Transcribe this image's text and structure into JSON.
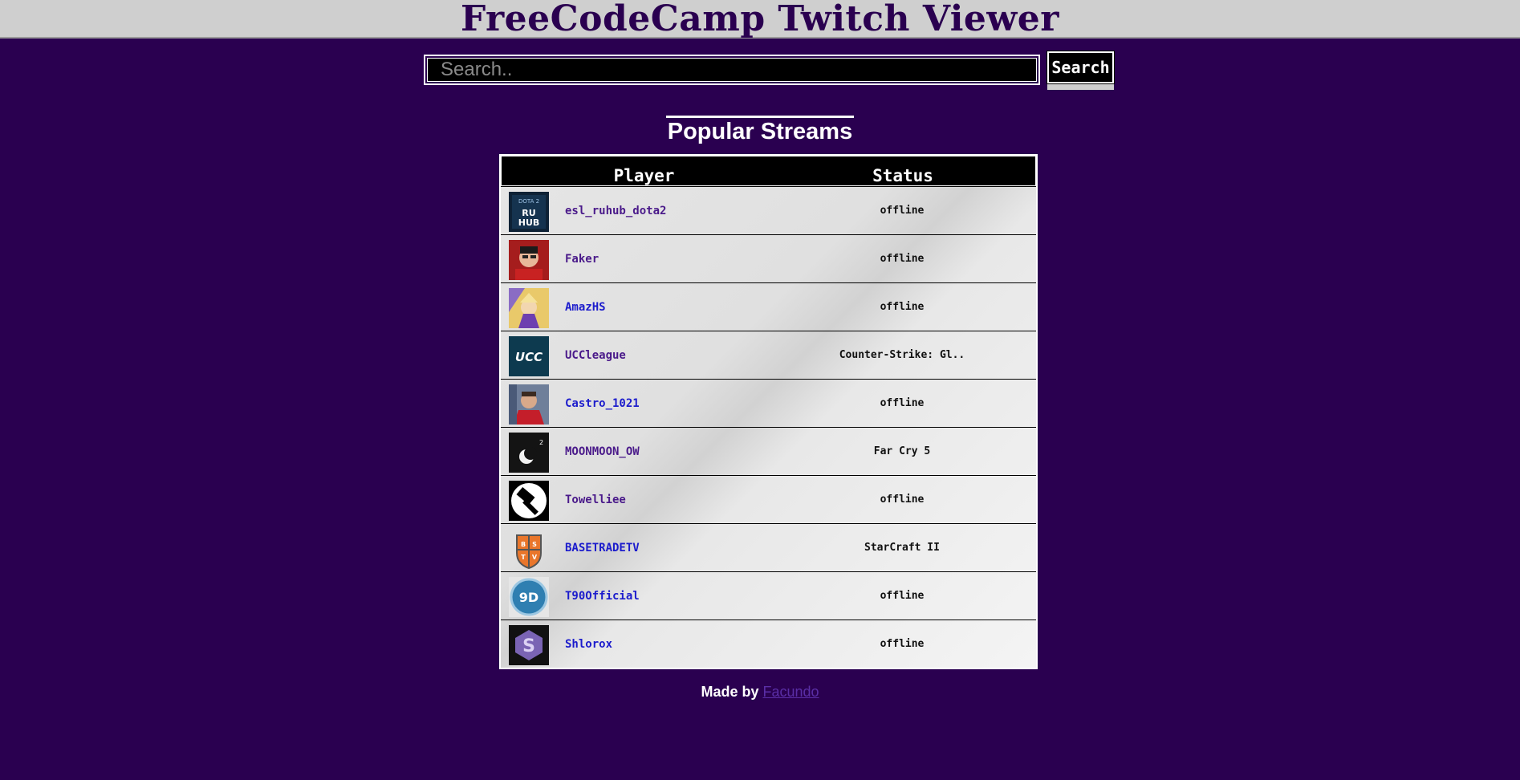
{
  "header": {
    "title": "FreeCodeCamp Twitch Viewer"
  },
  "search": {
    "placeholder": "Search..",
    "button_label": "Search"
  },
  "section": {
    "title": "Popular Streams"
  },
  "table": {
    "columns": [
      "Player",
      "Status"
    ],
    "rows": [
      {
        "player": "esl_ruhub_dota2",
        "status": "offline",
        "avatar": "ruhub-logo-icon",
        "color": "purple"
      },
      {
        "player": "Faker",
        "status": "offline",
        "avatar": "faker-avatar-icon",
        "color": "purple"
      },
      {
        "player": "AmazHS",
        "status": "offline",
        "avatar": "amazhs-avatar-icon",
        "color": "blue"
      },
      {
        "player": "UCCleague",
        "status": "Counter-Strike: Gl..",
        "avatar": "ucc-logo-icon",
        "color": "purple"
      },
      {
        "player": "Castro_1021",
        "status": "offline",
        "avatar": "castro-avatar-icon",
        "color": "blue"
      },
      {
        "player": "MOONMOON_OW",
        "status": "Far Cry 5",
        "avatar": "moon-logo-icon",
        "color": "purple"
      },
      {
        "player": "Towelliee",
        "status": "offline",
        "avatar": "hammer-logo-icon",
        "color": "purple"
      },
      {
        "player": "BASETRADETV",
        "status": "StarCraft II",
        "avatar": "btv-shield-icon",
        "color": "blue"
      },
      {
        "player": "T90Official",
        "status": "offline",
        "avatar": "t90-logo-icon",
        "color": "blue"
      },
      {
        "player": "Shlorox",
        "status": "offline",
        "avatar": "shlorox-logo-icon",
        "color": "blue"
      }
    ]
  },
  "footer": {
    "prefix": "Made by ",
    "author": "Facundo"
  },
  "colors": {
    "background": "#2a0050",
    "topbar": "#cfcfcf",
    "link_purple": "#4a1a8a",
    "link_blue": "#1c1ccc"
  }
}
